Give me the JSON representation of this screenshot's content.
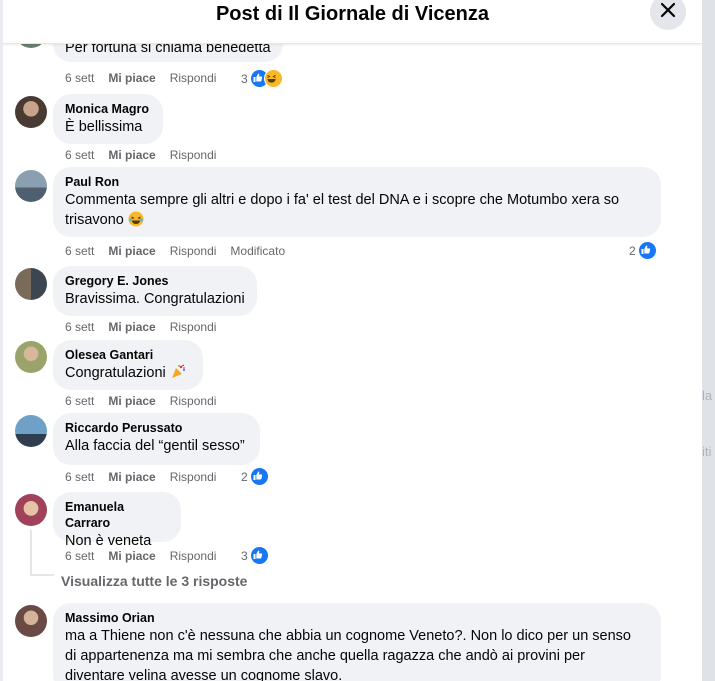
{
  "header": {
    "title": "Post di Il Giornale di Vicenza"
  },
  "backdrop": {
    "fragments": [
      "la",
      "iti"
    ]
  },
  "comments": [
    {
      "author": "",
      "text": "Per fortuna si chiama benedetta",
      "time": "6 sett",
      "like": "Mi piace",
      "reply": "Rispondi",
      "edited": "",
      "reaction_count": "3"
    },
    {
      "author": "Monica Magro",
      "text": "È bellissima",
      "time": "6 sett",
      "like": "Mi piace",
      "reply": "Rispondi",
      "edited": "",
      "reaction_count": ""
    },
    {
      "author": "Paul Ron",
      "text_line1": "Commenta sempre gli altri e dopo i fa' el test del DNA e i scopre che Motumbo xera so",
      "text_line2": "trisavono",
      "time": "6 sett",
      "like": "Mi piace",
      "reply": "Rispondi",
      "edited": "Modificato",
      "reaction_count": "2"
    },
    {
      "author": "Gregory E. Jones",
      "text": "Bravissima. Congratulazioni",
      "time": "6 sett",
      "like": "Mi piace",
      "reply": "Rispondi",
      "edited": "",
      "reaction_count": ""
    },
    {
      "author": "Olesea Gantari",
      "text": "Congratulazioni",
      "time": "6 sett",
      "like": "Mi piace",
      "reply": "Rispondi",
      "edited": "",
      "reaction_count": ""
    },
    {
      "author": "Riccardo Perussato",
      "text": "Alla faccia del “gentil sesso”",
      "time": "6 sett",
      "like": "Mi piace",
      "reply": "Rispondi",
      "edited": "",
      "reaction_count": "2"
    },
    {
      "author": "Emanuela Carraro",
      "text": "Non è veneta",
      "time": "6 sett",
      "like": "Mi piace",
      "reply": "Rispondi",
      "edited": "",
      "reaction_count": "3"
    },
    {
      "author": "Massimo Orian",
      "text_line1": "ma a Thiene non c'è nessuna che abbia un cognome Veneto?. Non lo dico per un senso",
      "text_line2": "di appartenenza ma mi sembra che anche quella ragazza che andò ai provini per",
      "text_line3": "diventare velina avesse un cognome slavo."
    }
  ],
  "replies_link": "Visualizza tutte le 3 risposte",
  "colors": {
    "accent": "#1877f2",
    "bubble": "#f0f2f5",
    "meta": "#65676b"
  }
}
